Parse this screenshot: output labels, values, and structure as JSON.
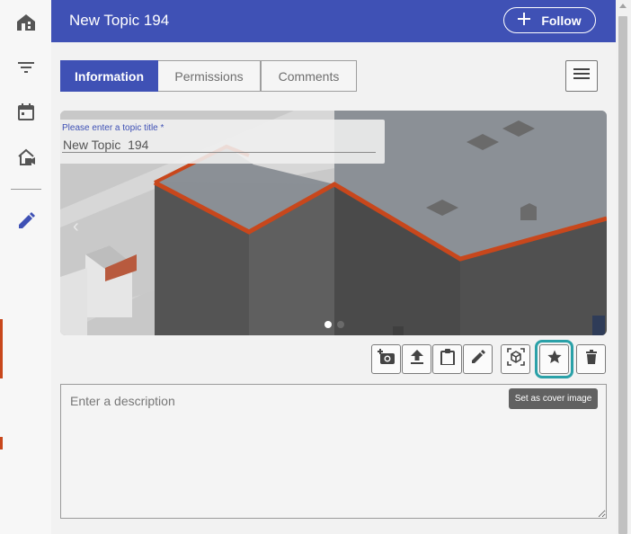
{
  "sidebar": {
    "items": [
      {
        "icon": "home-icon"
      },
      {
        "icon": "filter-icon"
      },
      {
        "icon": "calendar-icon"
      },
      {
        "icon": "house-camera-icon"
      },
      {
        "icon": "pencil-icon",
        "active": true
      }
    ]
  },
  "header": {
    "title": "New Topic 194",
    "follow_label": "Follow",
    "background": "#3f51b5"
  },
  "tabs": [
    {
      "label": "Information",
      "active": true
    },
    {
      "label": "Permissions"
    },
    {
      "label": "Comments"
    }
  ],
  "topic_title": {
    "label": "Please enter a topic title *",
    "value": "New Topic  194"
  },
  "carousel": {
    "prev_glyph": "‹",
    "slide_count": 2,
    "active_slide": 1
  },
  "toolbar": [
    {
      "name": "add-photo-button",
      "icon": "camera-plus-icon"
    },
    {
      "name": "upload-button",
      "icon": "upload-icon"
    },
    {
      "name": "paste-button",
      "icon": "clipboard-icon"
    },
    {
      "name": "edit-image-button",
      "icon": "pencil-icon"
    },
    {
      "name": "view-3d-button",
      "icon": "cube-icon"
    },
    {
      "name": "set-cover-button",
      "icon": "star-icon",
      "highlighted": true
    },
    {
      "name": "delete-button",
      "icon": "trash-icon"
    }
  ],
  "tooltip": "Set as cover image",
  "description": {
    "placeholder": "Enter a description"
  },
  "colors": {
    "accent": "#3f51b5",
    "highlight": "#2aa1a8",
    "roof_edge": "#c8471c"
  }
}
